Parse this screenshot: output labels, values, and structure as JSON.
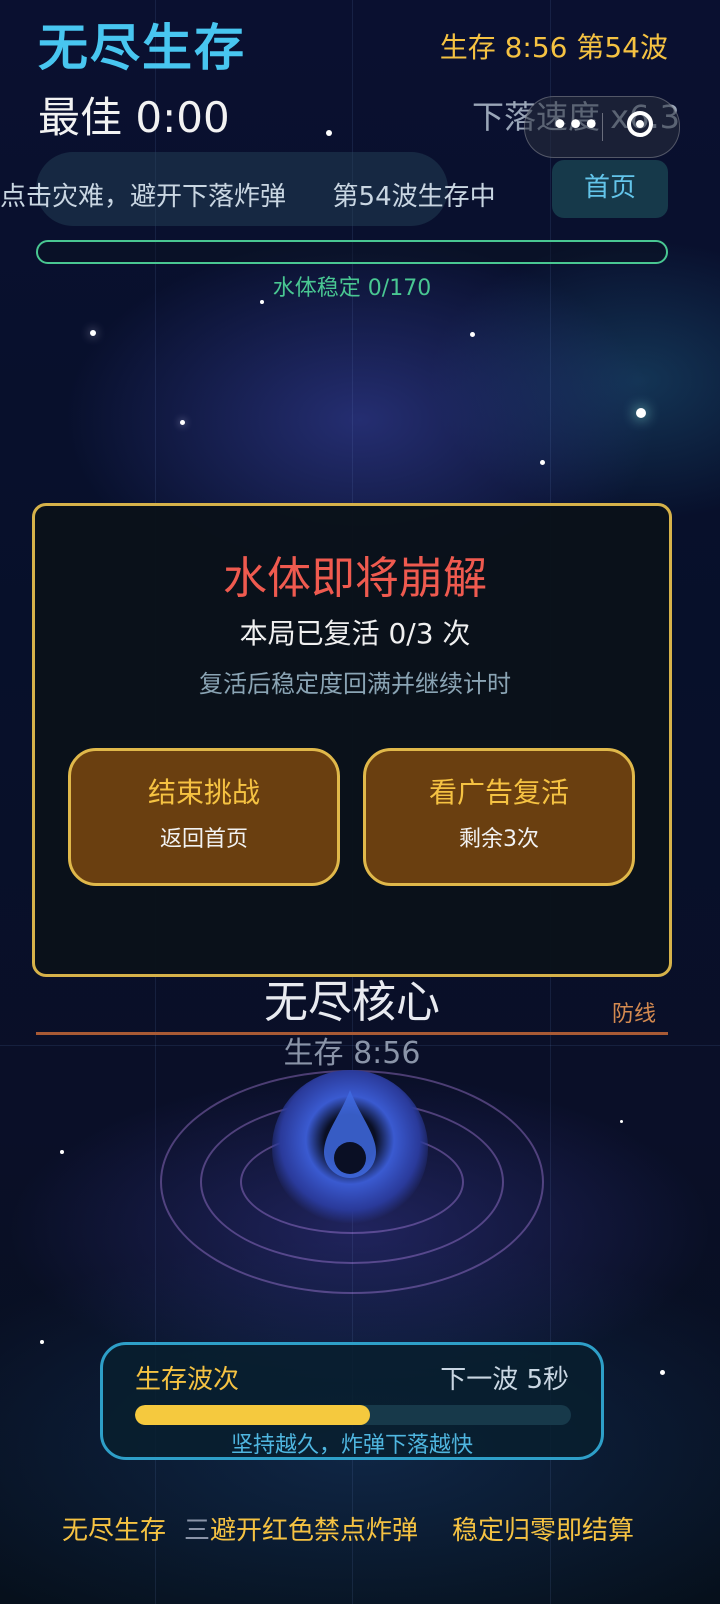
{
  "header": {
    "title": "无尽生存",
    "best": "最佳 0:00",
    "status": "生存 8:56  第54波",
    "speed": "下落速度 x6.3"
  },
  "hint": {
    "text": "点击灾难，避开下落炸弹",
    "wave_status": "第54波生存中"
  },
  "nav": {
    "home_label": "首页"
  },
  "stability": {
    "label": "水体稳定 0/170",
    "fraction": 0
  },
  "core": {
    "name": "无尽核心",
    "survival": "生存 8:56",
    "defense_label": "防线"
  },
  "modal": {
    "title": "水体即将崩解",
    "revive_count": "本局已复活 0/3 次",
    "description": "复活后稳定度回满并继续计时",
    "end_button": {
      "label": "结束挑战",
      "sub": "返回首页"
    },
    "revive_button": {
      "label": "看广告复活",
      "sub": "剩余3次"
    }
  },
  "wave_panel": {
    "label": "生存波次",
    "next": "下一波 5秒",
    "progress": 0.54,
    "tip": "坚持越久，炸弹下落越快"
  },
  "footer": {
    "left": "无尽生存",
    "mid_glyph": "三",
    "mid": "避开红色禁点炸弹",
    "right": "稳定归零即结算"
  },
  "colors": {
    "title": "#48c6f0",
    "accent_gold": "#f5c242",
    "stability_green": "#49c792",
    "modal_title_red": "#ef5a4f",
    "modal_border": "#d6b24a",
    "button_fill": "#6a3f10"
  },
  "icons": {
    "menu": "more-dots-icon",
    "close": "target-circle-icon"
  }
}
